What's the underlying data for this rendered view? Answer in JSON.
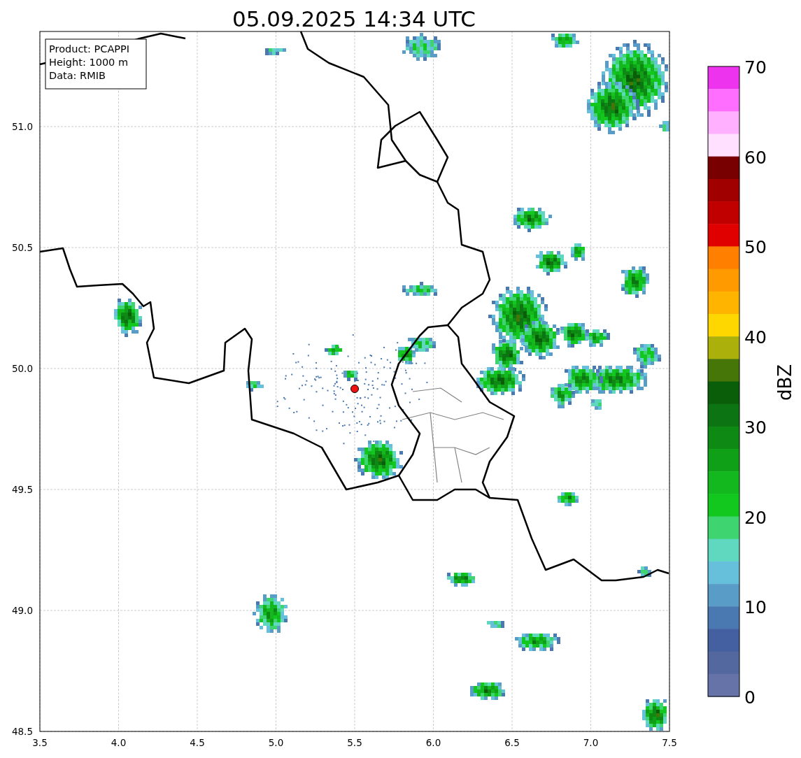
{
  "title": "05.09.2025 14:34 UTC",
  "map": {
    "info_box": [
      "Product: PCAPPI",
      "Height: 1000 m",
      "Data: RMIB"
    ],
    "xticks": [
      "3.5",
      "4.0",
      "4.5",
      "5.0",
      "5.5",
      "6.0",
      "6.5",
      "7.0",
      "7.5"
    ],
    "yticks": [
      "51.0",
      "50.5",
      "50.0",
      "49.5",
      "49.0",
      "48.5"
    ]
  },
  "colorbar": {
    "label": "dBZ",
    "ticks": [
      "70",
      "60",
      "50",
      "40",
      "30",
      "20",
      "10",
      "0"
    ],
    "bins": [
      {
        "color": "#ee33ee"
      },
      {
        "color": "#ff6eff"
      },
      {
        "color": "#ffb0ff"
      },
      {
        "color": "#ffe0ff"
      },
      {
        "color": "#780000"
      },
      {
        "color": "#a00000"
      },
      {
        "color": "#c00000"
      },
      {
        "color": "#e00000"
      },
      {
        "color": "#ff7f00"
      },
      {
        "color": "#ff9a00"
      },
      {
        "color": "#ffb400"
      },
      {
        "color": "#ffd700"
      },
      {
        "color": "#acb00a"
      },
      {
        "color": "#467608"
      },
      {
        "color": "#0a5e0a"
      },
      {
        "color": "#0c7412"
      },
      {
        "color": "#0e8a14"
      },
      {
        "color": "#0fa018"
      },
      {
        "color": "#12b81e"
      },
      {
        "color": "#12c81e"
      },
      {
        "color": "#3ed470"
      },
      {
        "color": "#60d8c0"
      },
      {
        "color": "#66c0dc"
      },
      {
        "color": "#5a9cc8"
      },
      {
        "color": "#4a78b0"
      },
      {
        "color": "#4560a0"
      },
      {
        "color": "#5468a0"
      },
      {
        "color": "#6673a8"
      }
    ]
  }
}
